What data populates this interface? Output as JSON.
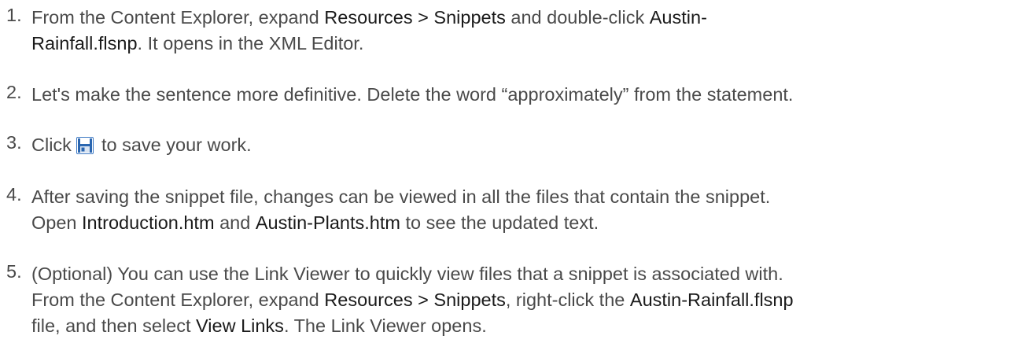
{
  "steps": [
    {
      "number": "1.",
      "line1": {
        "t1": "From the Content Explorer, expand ",
        "b1": "Resources > Snippets",
        "t2": " and double-click ",
        "b2": "Austin-"
      },
      "line2": {
        "b1": "Rainfall.flsnp",
        "t1": ". It opens in the XML Editor."
      }
    },
    {
      "number": "2.",
      "line1": {
        "t1": "Let's make the sentence more definitive. Delete the word “approximately” from the statement."
      }
    },
    {
      "number": "3.",
      "line1": {
        "t1": "Click ",
        "icon": "save-icon",
        "t2": " to save your work."
      }
    },
    {
      "number": "4.",
      "line1": {
        "t1": "After saving the snippet file, changes can be viewed in all the files that contain the snippet."
      },
      "line2": {
        "t1": "Open ",
        "b1": "Introduction.htm",
        "t2": " and ",
        "b2": "Austin-Plants.htm",
        "t3": " to see the updated text."
      }
    },
    {
      "number": "5.",
      "line1": {
        "t1": "(Optional) You can use the Link Viewer to quickly view files that a snippet is associated with."
      },
      "line2": {
        "t1": "From the Content Explorer, expand ",
        "b1": "Resources > Snippets",
        "t2": ", right-click the ",
        "b2": "Austin-Rainfall.flsnp"
      },
      "line3": {
        "t1": "file, and then select ",
        "b1": "View Links",
        "t2": ". The Link Viewer opens."
      }
    }
  ],
  "colors": {
    "text": "#4a4a4a",
    "bold": "#1a1a1a",
    "icon_blue": "#1f5fa8"
  }
}
